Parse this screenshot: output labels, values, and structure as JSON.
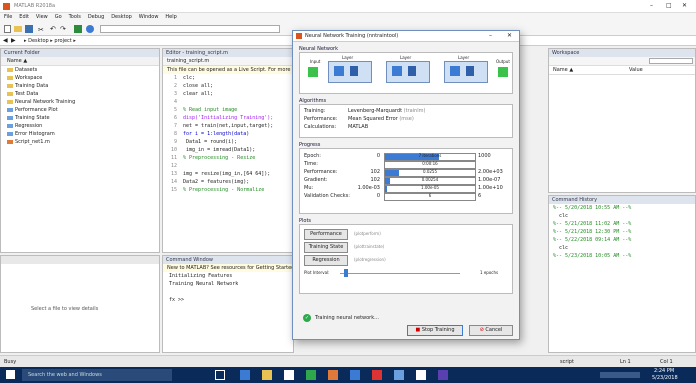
{
  "window": {
    "title": "MATLAB R2018a"
  },
  "menu": [
    "File",
    "Edit",
    "View",
    "Go",
    "Tools",
    "Debug",
    "Desktop",
    "Window",
    "Help"
  ],
  "path": {
    "text": "▸ Desktop ▸ project ▸"
  },
  "current_folder": {
    "title": "Current Folder",
    "column": "Name ▲",
    "items": [
      "Datasets",
      "Workspace",
      "Training Data",
      "Test Data",
      "Neural Network Training",
      "Performance Plot",
      "Training State",
      "Regression",
      "Error Histogram",
      "Script_net1.m"
    ]
  },
  "editor": {
    "title": "Editor - training_script.m",
    "tab": "training_script.m",
    "banner": "This file can be opened as a Live Script. For more information, see Creating Live Scripts.",
    "lines": [
      {
        "n": "1",
        "code": "clc;"
      },
      {
        "n": "2",
        "code": "close all;"
      },
      {
        "n": "3",
        "code": "clear all;"
      },
      {
        "n": "4",
        "code": ""
      },
      {
        "n": "5",
        "code": "% Read input image"
      },
      {
        "n": "6",
        "code": "disp('Initializing Training');"
      },
      {
        "n": "7",
        "code": "net = train(net,input,target);"
      },
      {
        "n": "8",
        "code": "for i = 1:length(data)"
      },
      {
        "n": "9",
        "code": "    Data1 = round(i);"
      },
      {
        "n": "10",
        "code": "    img_in = imread(Data1);"
      },
      {
        "n": "11",
        "code": "% Preprocessing - Resize"
      },
      {
        "n": "12",
        "code": ""
      },
      {
        "n": "13",
        "code": "img = resize(img_in,[64 64]);"
      },
      {
        "n": "14",
        "code": "Data2 = features(img);"
      },
      {
        "n": "15",
        "code": "% Preprocessing - Normalize"
      }
    ]
  },
  "command_window": {
    "title": "Command Window",
    "notice": "New to MATLAB? See resources for Getting Started.",
    "lines": [
      "Initializing Features",
      "Training Neural Network"
    ],
    "prompt": "fx >>"
  },
  "details": {
    "text": "Select a file to view details"
  },
  "workspace": {
    "title": "Workspace",
    "col_name": "Name ▲",
    "col_value": "Value"
  },
  "history": {
    "title": "Command History",
    "lines": [
      "%-- 5/20/2018 10:55 AM --%",
      "clc",
      "%-- 5/21/2018 11:02 AM --%",
      "%-- 5/21/2018 12:30 PM --%",
      "%-- 5/22/2018 09:14 AM --%",
      "clc",
      "%-- 5/23/2018 10:05 AM --%"
    ]
  },
  "dialog": {
    "title": "Neural Network Training (nntraintool)",
    "sections": {
      "network": "Neural Network",
      "algorithms": "Algorithms",
      "progress": "Progress",
      "plots": "Plots"
    },
    "diagram": {
      "input": "Input",
      "output": "Output",
      "layers": [
        "Layer",
        "Layer",
        "Layer"
      ]
    },
    "algorithms": [
      {
        "label": "Training:",
        "value": "Levenberg-Marquardt",
        "extra": "(trainlm)"
      },
      {
        "label": "Performance:",
        "value": "Mean Squared Error",
        "extra": "(mse)"
      },
      {
        "label": "Calculations:",
        "value": "MATLAB"
      }
    ],
    "progress_header": {
      "min": "",
      "val": "",
      "max": ""
    },
    "progress": [
      {
        "label": "Epoch:",
        "min": "0",
        "val": "7 iterations",
        "max": "1000",
        "frac": 0.6
      },
      {
        "label": "Time:",
        "min": "",
        "val": "0:00:16",
        "max": "",
        "frac": 0
      },
      {
        "label": "Performance:",
        "min": "102",
        "val": "0.0255",
        "max": "2.00e+03",
        "frac": 0.15
      },
      {
        "label": "Gradient:",
        "min": "102",
        "val": "0.00254",
        "max": "1.00e-07",
        "frac": 0.05
      },
      {
        "label": "Mu:",
        "min": "1.00e-03",
        "val": "1.00e-05",
        "max": "1.00e+10",
        "frac": 0.02
      },
      {
        "label": "Validation Checks:",
        "min": "0",
        "val": "6",
        "max": "6",
        "frac": 0
      }
    ],
    "plots": [
      {
        "button": "Performance",
        "extra": "(plotperform)"
      },
      {
        "button": "Training State",
        "extra": "(plottrainstate)"
      },
      {
        "button": "Regression",
        "extra": "(plotregression)"
      }
    ],
    "plot_interval": {
      "label": "Plot Interval:",
      "value": "1 epochs"
    },
    "status": "Training neural network...",
    "buttons": {
      "stop": "Stop Training",
      "cancel": "Cancel"
    }
  },
  "statusbar": {
    "left": "Busy",
    "right1": "script",
    "right2": "Ln 1",
    "right3": "Col 1"
  },
  "taskbar": {
    "search": "Search the web and Windows",
    "time": "2:24 PM",
    "date": "5/23/2018"
  },
  "colors": {
    "taskbar": "#0a2a5a",
    "accent": "#3b7bd4",
    "dialog_border": "#6f8fbf"
  }
}
